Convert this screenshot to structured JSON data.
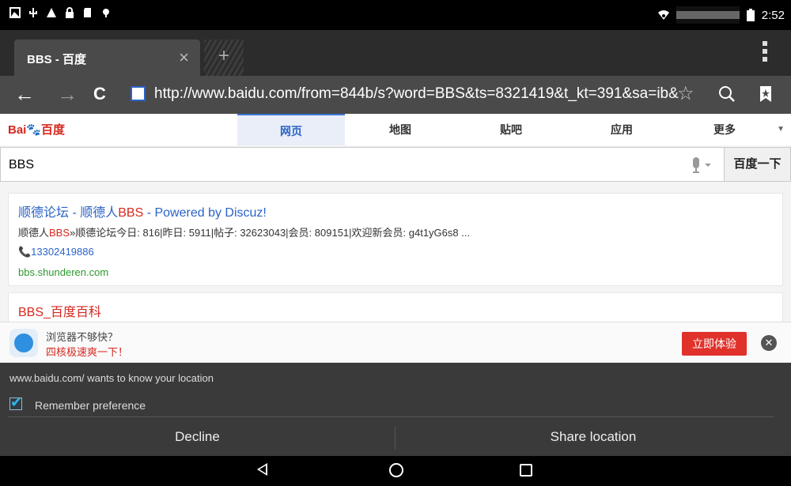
{
  "status_bar": {
    "time": "2:52"
  },
  "tab": {
    "title": "BBS - 百度",
    "close_glyph": "×",
    "new_tab_glyph": "+"
  },
  "url_bar": {
    "back_glyph": "←",
    "forward_glyph": "→",
    "reload_glyph": "C",
    "url": "http://www.baidu.com/from=844b/s?word=BBS&ts=8321419&t_kt=391&sa=ib&",
    "star_glyph": "☆",
    "search_glyph": "🔍",
    "bookmark_glyph": "🔖"
  },
  "baidu": {
    "logo_part1": "Bai",
    "logo_part2": "百度",
    "tabs": [
      {
        "label": "网页",
        "active": true
      },
      {
        "label": "地图",
        "active": false
      },
      {
        "label": "贴吧",
        "active": false
      },
      {
        "label": "应用",
        "active": false
      },
      {
        "label": "更多",
        "active": false
      }
    ],
    "more_arrow": "▼",
    "search": {
      "value": "BBS",
      "button_label": "百度一下",
      "mic_glyph": "🎤"
    }
  },
  "results": [
    {
      "title_pre": "顺德论坛 - 顺德人",
      "title_hl": "BBS",
      "title_post": " - Powered by Discuz!",
      "snippet_pre": "顺德人",
      "snippet_hl": "BBS",
      "snippet_post": "»顺德论坛今日: 816|昨日: 5911|帖子: 32623043|会员: 809151|欢迎新会员: g4t1yG6s8 ...",
      "phone": "📞13302419886",
      "url": "bbs.shunderen.com"
    },
    {
      "title": "BBS_百度百科"
    }
  ],
  "promo": {
    "line1": "浏览器不够快？",
    "line2": "四核极速爽一下！",
    "button_label": "立即体验",
    "close_glyph": "✕"
  },
  "location_dialog": {
    "message": "www.baidu.com/ wants to know your location",
    "remember_label": "Remember preference",
    "remember_checked": true,
    "decline_label": "Decline",
    "share_label": "Share location"
  },
  "colors": {
    "baidu_blue": "#2b63c7",
    "baidu_red": "#d7281f",
    "url_green": "#2d9a2d",
    "promo_button": "#e0322b",
    "dialog_bg": "#3a3a3a"
  }
}
